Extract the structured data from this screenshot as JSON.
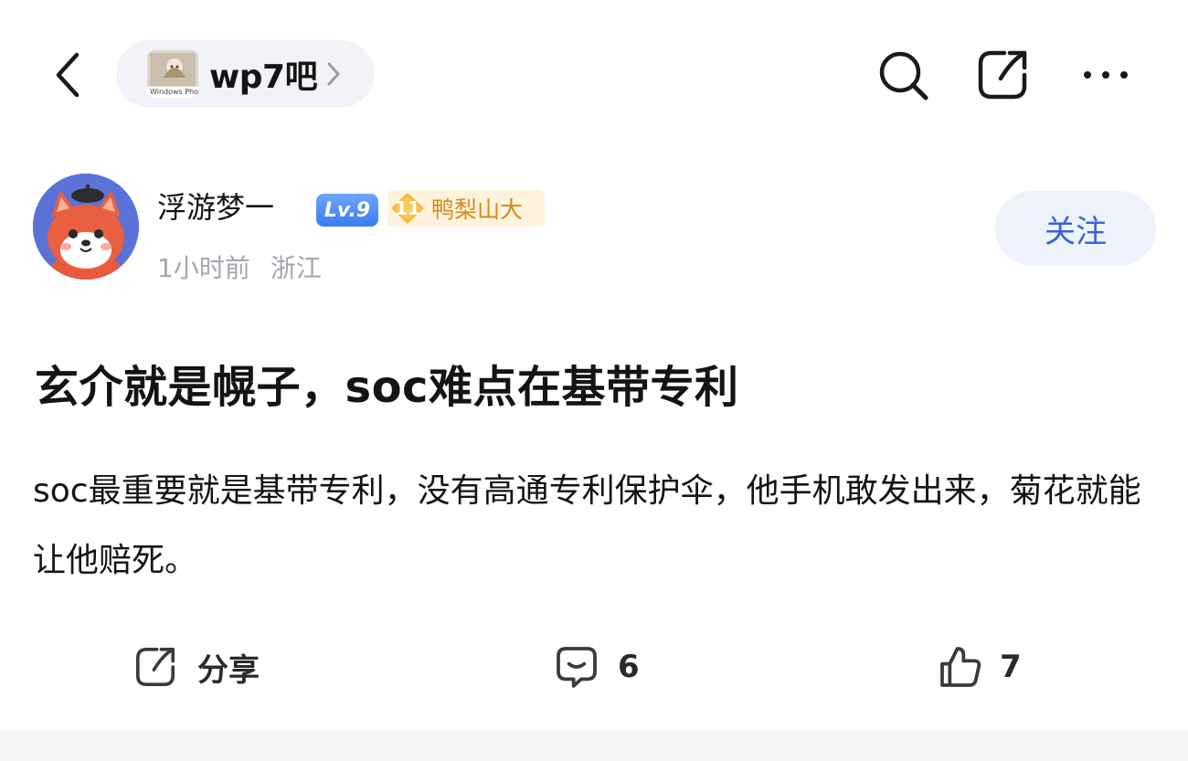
{
  "header": {
    "back_icon": "chevron-left-icon",
    "forum_thumb_caption": "Windows Pho",
    "forum_name": "wp7吧",
    "forum_chevron_icon": "chevron-right-icon",
    "search_icon": "search-icon",
    "share_icon": "share-icon",
    "more_icon": "more-horizontal-icon"
  },
  "author": {
    "name": "浮游梦一",
    "level_badge": "Lv.9",
    "rank_level": "11",
    "rank_title": "鸭梨山大",
    "time": "1小时前",
    "location": "浙江",
    "follow_label": "关注"
  },
  "post": {
    "title": "玄介就是幌子，soc难点在基带专利",
    "body": "soc最重要就是基带专利，没有高通专利保护伞，他手机敢发出来，菊花就能让他赔死。"
  },
  "actions": {
    "share_label": "分享",
    "comment_count": "6",
    "like_count": "7"
  },
  "colors": {
    "accent_blue": "#3a63d8",
    "level_badge_blue": "#3a7cf2",
    "rank_gold": "#f4b938",
    "muted_text": "#a4a7ad"
  }
}
